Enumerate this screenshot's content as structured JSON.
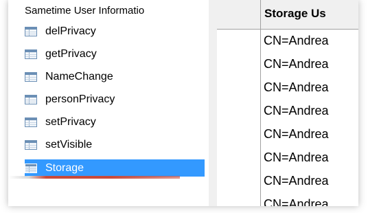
{
  "tree": {
    "header": "Sametime User Informatio",
    "items": [
      {
        "label": "delPrivacy",
        "selected": false
      },
      {
        "label": "getPrivacy",
        "selected": false
      },
      {
        "label": "NameChange",
        "selected": false
      },
      {
        "label": "personPrivacy",
        "selected": false
      },
      {
        "label": "setPrivacy",
        "selected": false
      },
      {
        "label": "setVisible",
        "selected": false
      },
      {
        "label": "Storage",
        "selected": true
      }
    ],
    "item_icon": "table-icon"
  },
  "grid": {
    "column_header": "Storage Us",
    "rows": [
      "CN=Andrea",
      "CN=Andrea",
      "CN=Andrea",
      "CN=Andrea",
      "CN=Andrea",
      "CN=Andrea",
      "CN=Andrea",
      "CN=Andrea"
    ]
  },
  "colors": {
    "selection": "#3399ff",
    "accent_line": "#c84a3a"
  }
}
